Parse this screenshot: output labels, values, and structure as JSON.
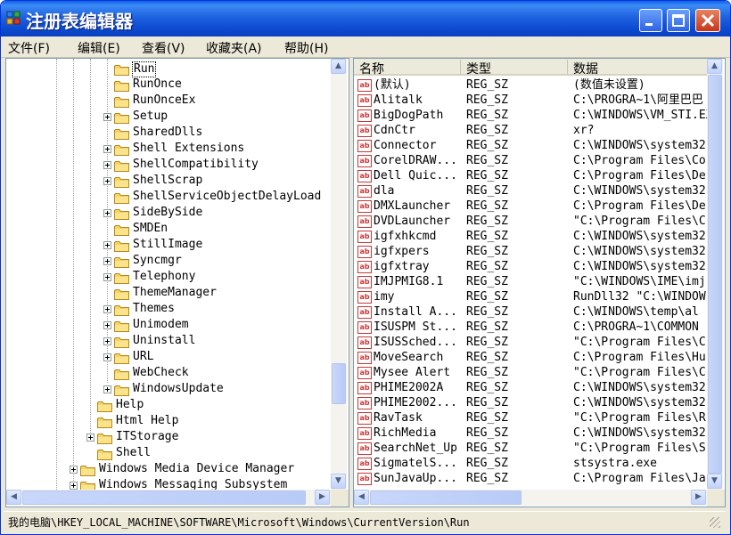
{
  "window": {
    "title": "注册表编辑器"
  },
  "menu": [
    "文件(F)",
    "编辑(E)",
    "查看(V)",
    "收藏夹(A)",
    "帮助(H)"
  ],
  "tree": [
    {
      "label": "Run",
      "depth": 3,
      "expander": false,
      "selected": true
    },
    {
      "label": "RunOnce",
      "depth": 3,
      "expander": false
    },
    {
      "label": "RunOnceEx",
      "depth": 3,
      "expander": false
    },
    {
      "label": "Setup",
      "depth": 3,
      "expander": true
    },
    {
      "label": "SharedDlls",
      "depth": 3,
      "expander": false
    },
    {
      "label": "Shell Extensions",
      "depth": 3,
      "expander": true
    },
    {
      "label": "ShellCompatibility",
      "depth": 3,
      "expander": true
    },
    {
      "label": "ShellScrap",
      "depth": 3,
      "expander": true
    },
    {
      "label": "ShellServiceObjectDelayLoad",
      "depth": 3,
      "expander": false
    },
    {
      "label": "SideBySide",
      "depth": 3,
      "expander": true
    },
    {
      "label": "SMDEn",
      "depth": 3,
      "expander": false
    },
    {
      "label": "StillImage",
      "depth": 3,
      "expander": true
    },
    {
      "label": "Syncmgr",
      "depth": 3,
      "expander": true
    },
    {
      "label": "Telephony",
      "depth": 3,
      "expander": true
    },
    {
      "label": "ThemeManager",
      "depth": 3,
      "expander": false
    },
    {
      "label": "Themes",
      "depth": 3,
      "expander": true
    },
    {
      "label": "Unimodem",
      "depth": 3,
      "expander": true
    },
    {
      "label": "Uninstall",
      "depth": 3,
      "expander": true
    },
    {
      "label": "URL",
      "depth": 3,
      "expander": true
    },
    {
      "label": "WebCheck",
      "depth": 3,
      "expander": false
    },
    {
      "label": "WindowsUpdate",
      "depth": 3,
      "expander": true
    },
    {
      "label": "Help",
      "depth": 2,
      "expander": false
    },
    {
      "label": "Html Help",
      "depth": 2,
      "expander": false
    },
    {
      "label": "ITStorage",
      "depth": 2,
      "expander": true
    },
    {
      "label": "Shell",
      "depth": 2,
      "expander": false
    },
    {
      "label": "Windows Media Device Manager",
      "depth": 1,
      "expander": true
    },
    {
      "label": "Windows Messaging Subsystem",
      "depth": 1,
      "expander": true
    }
  ],
  "list": {
    "columns": [
      "名称",
      "类型",
      "数据"
    ],
    "icon": "ab",
    "rows": [
      [
        "(默认)",
        "REG_SZ",
        "(数值未设置)"
      ],
      [
        "Alitalk",
        "REG_SZ",
        "C:\\PROGRA~1\\阿里巴巴"
      ],
      [
        "BigDogPath",
        "REG_SZ",
        "C:\\WINDOWS\\VM_STI.EXE"
      ],
      [
        "CdnCtr",
        "REG_SZ",
        "xr?"
      ],
      [
        "Connector",
        "REG_SZ",
        "C:\\WINDOWS\\system32"
      ],
      [
        "CorelDRAW...",
        "REG_SZ",
        "C:\\Program Files\\Co"
      ],
      [
        "Dell Quic...",
        "REG_SZ",
        "C:\\Program Files\\De"
      ],
      [
        "dla",
        "REG_SZ",
        "C:\\WINDOWS\\system32"
      ],
      [
        "DMXLauncher",
        "REG_SZ",
        "C:\\Program Files\\De"
      ],
      [
        "DVDLauncher",
        "REG_SZ",
        "\"C:\\Program Files\\C"
      ],
      [
        "igfxhkcmd",
        "REG_SZ",
        "C:\\WINDOWS\\system32"
      ],
      [
        "igfxpers",
        "REG_SZ",
        "C:\\WINDOWS\\system32"
      ],
      [
        "igfxtray",
        "REG_SZ",
        "C:\\WINDOWS\\system32"
      ],
      [
        "IMJPMIG8.1",
        "REG_SZ",
        "\"C:\\WINDOWS\\IME\\imj"
      ],
      [
        "imy",
        "REG_SZ",
        "RunDll32 \"C:\\WINDOW"
      ],
      [
        "Install A...",
        "REG_SZ",
        "C:\\WINDOWS\\temp\\al"
      ],
      [
        "ISUSPM St...",
        "REG_SZ",
        "C:\\PROGRA~1\\COMMON"
      ],
      [
        "ISUSSched...",
        "REG_SZ",
        "\"C:\\Program Files\\C"
      ],
      [
        "MoveSearch",
        "REG_SZ",
        "C:\\Program Files\\Hu"
      ],
      [
        "Mysee Alert",
        "REG_SZ",
        "\"C:\\Program Files\\C"
      ],
      [
        "PHIME2002A",
        "REG_SZ",
        "C:\\WINDOWS\\system32"
      ],
      [
        "PHIME2002...",
        "REG_SZ",
        "C:\\WINDOWS\\system32"
      ],
      [
        "RavTask",
        "REG_SZ",
        "\"C:\\Program Files\\R"
      ],
      [
        "RichMedia",
        "REG_SZ",
        "C:\\WINDOWS\\system32"
      ],
      [
        "SearchNet_Up",
        "REG_SZ",
        "\"C:\\Program Files\\S"
      ],
      [
        "SigmatelS...",
        "REG_SZ",
        "stsystra.exe"
      ],
      [
        "SunJavaUp...",
        "REG_SZ",
        "C:\\Program Files\\Ja"
      ],
      [
        "",
        "",
        ""
      ]
    ]
  },
  "status": "我的电脑\\HKEY_LOCAL_MACHINE\\SOFTWARE\\Microsoft\\Windows\\CurrentVersion\\Run"
}
